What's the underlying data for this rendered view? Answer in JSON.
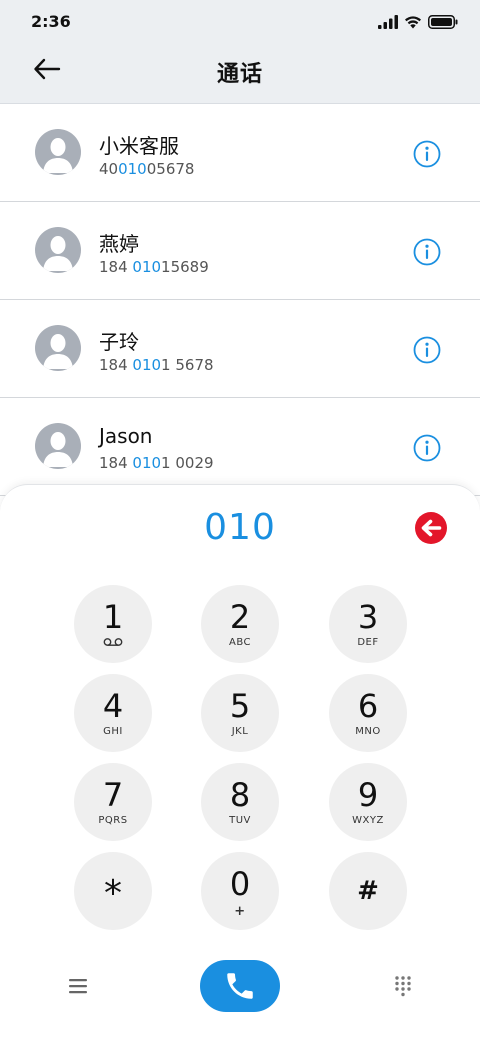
{
  "status_bar": {
    "time": "2:36"
  },
  "header": {
    "title": "通话"
  },
  "contacts": [
    {
      "name": "小米客服",
      "number_parts": [
        "40",
        "010",
        "05678"
      ]
    },
    {
      "name": "燕婷",
      "number_parts": [
        "184 ",
        "010",
        "15689"
      ]
    },
    {
      "name": "子玲",
      "number_parts": [
        "184 ",
        "010",
        "1 5678"
      ]
    },
    {
      "name": "Jason",
      "number_parts": [
        "184 ",
        "010",
        "1 0029"
      ]
    }
  ],
  "dialer": {
    "input": "010",
    "keys": [
      {
        "digit": "1",
        "sub": ""
      },
      {
        "digit": "2",
        "sub": "ABC"
      },
      {
        "digit": "3",
        "sub": "DEF"
      },
      {
        "digit": "4",
        "sub": "GHI"
      },
      {
        "digit": "5",
        "sub": "JKL"
      },
      {
        "digit": "6",
        "sub": "MNO"
      },
      {
        "digit": "7",
        "sub": "PQRS"
      },
      {
        "digit": "8",
        "sub": "TUV"
      },
      {
        "digit": "9",
        "sub": "WXYZ"
      },
      {
        "digit": "*",
        "sub": ""
      },
      {
        "digit": "0",
        "sub": "+"
      },
      {
        "digit": "#",
        "sub": ""
      }
    ]
  },
  "colors": {
    "accent": "#1a8fe0",
    "backspace": "#e3162a",
    "header_bg": "#eceff2"
  },
  "icons": [
    "back-arrow-icon",
    "info-icon",
    "backspace-icon",
    "voicemail-icon",
    "menu-icon",
    "phone-icon",
    "keypad-icon",
    "signal-icon",
    "wifi-icon",
    "battery-icon"
  ]
}
